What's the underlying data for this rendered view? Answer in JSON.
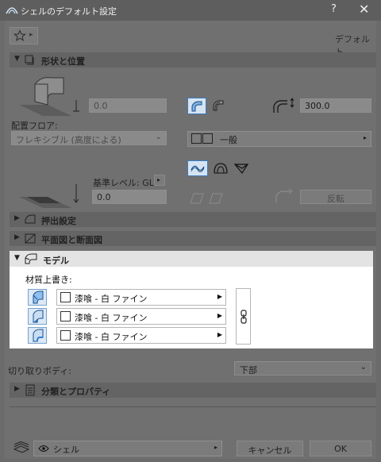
{
  "window": {
    "title": "シェルのデフォルト設定",
    "help": "?",
    "close": "✕"
  },
  "toolbar": {
    "favorites_arrow": "▸",
    "default_label": "デフォルト"
  },
  "sections": {
    "shape": "形状と位置",
    "extrude": "押出設定",
    "plan": "平面図と断面図",
    "model": "モデル",
    "classification": "分類とプロパティ"
  },
  "shape": {
    "height_value": "0.0",
    "floor_label": "配置フロア:",
    "floor_value": "フレキシブル (高度による)",
    "ref_level_label": "基準レベル: GL",
    "ref_level_value": "0.0",
    "thickness_value": "300.0",
    "type_value": "一般",
    "flip_label": "反転"
  },
  "model": {
    "material_override_label": "材質上書き:",
    "materials": [
      {
        "name": "漆喰 - 白 ファイン"
      },
      {
        "name": "漆喰 - 白 ファイン"
      },
      {
        "name": "漆喰 - 白 ファイン"
      }
    ]
  },
  "cut_body": {
    "label": "切り取りボディ:",
    "value": "下部"
  },
  "footer": {
    "layer_value": "シェル",
    "cancel": "キャンセル",
    "ok": "OK"
  },
  "colors": {
    "accent": "#2f7fd0",
    "highlight_bg": "#ffffff",
    "dim_bg": "#6e6e6e"
  }
}
